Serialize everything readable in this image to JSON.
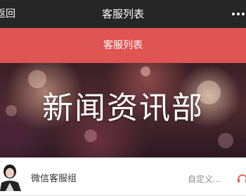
{
  "topbar": {
    "back_label": "返回",
    "title": "客服列表"
  },
  "section_header": {
    "label": "客服列表"
  },
  "banner": {
    "text": "新闻资讯部"
  },
  "list": [
    {
      "name": "微信客服组",
      "description": "自定义...",
      "icon": "headset-icon"
    }
  ],
  "colors": {
    "topbar_bg": "#262626",
    "accent_red": "#df5554"
  }
}
